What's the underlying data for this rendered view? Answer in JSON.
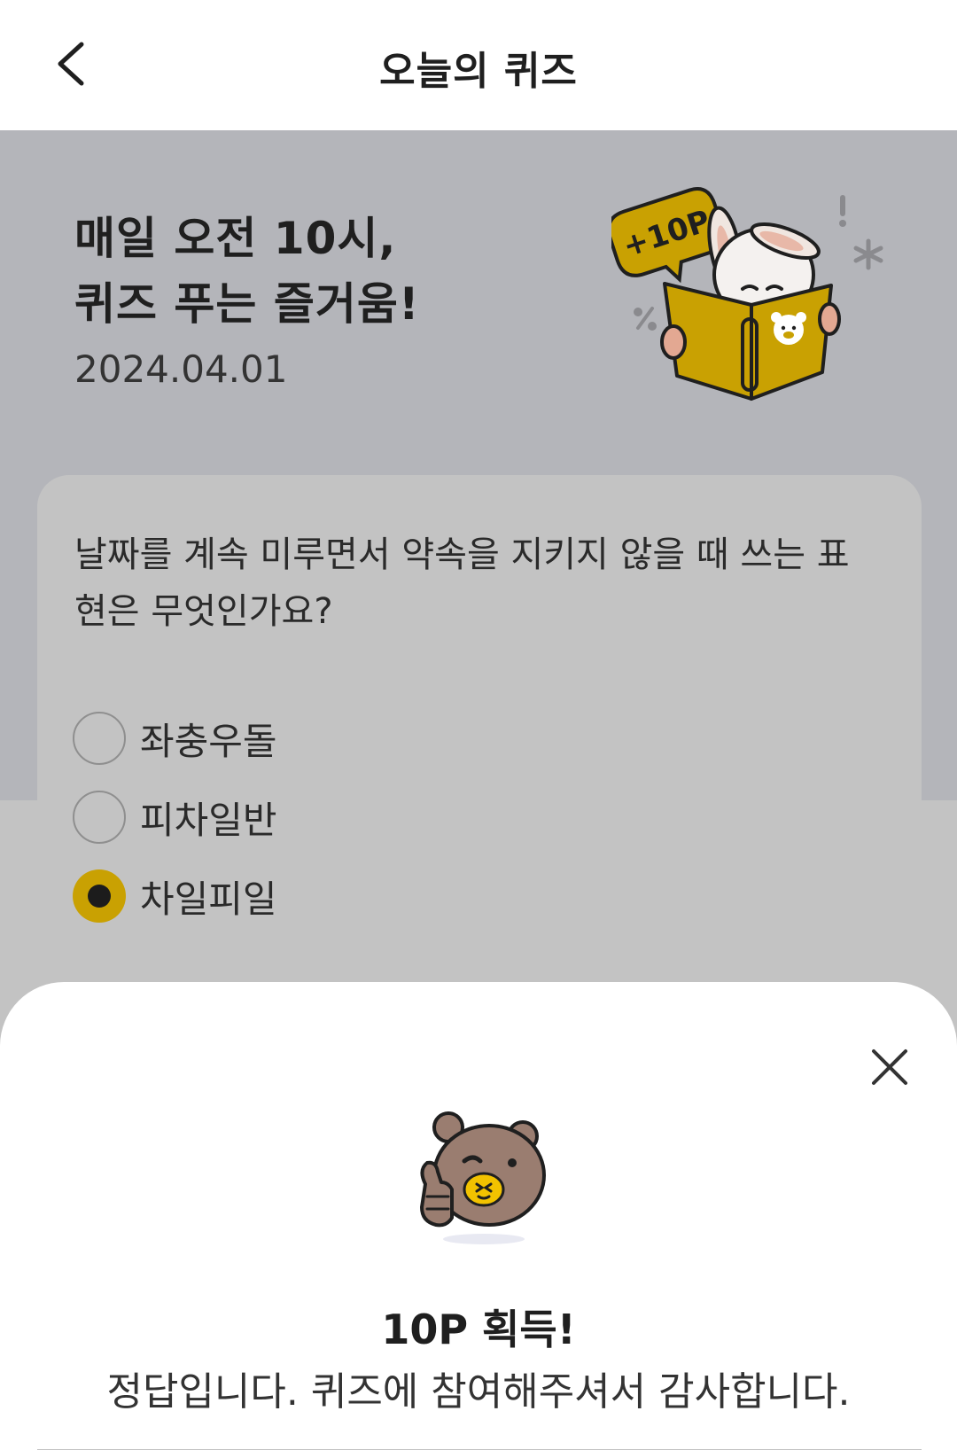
{
  "header": {
    "title": "오늘의 퀴즈",
    "back_icon": "chevron-left-icon"
  },
  "hero": {
    "title_line1": "매일 오전 10시,",
    "title_line2": "퀴즈 푸는 즐거움!",
    "date": "2024.04.01",
    "badge_text": "+10P",
    "illustration": "rabbit-reading-book-illustration"
  },
  "quiz": {
    "question": "날짜를 계속 미루면서 약속을 지키지 않을 때 쓰는 표현은 무엇인가요?",
    "options": [
      {
        "label": "좌충우돌",
        "selected": false
      },
      {
        "label": "피차일반",
        "selected": false
      },
      {
        "label": "차일피일",
        "selected": true
      }
    ]
  },
  "result_sheet": {
    "title": "10P 획득!",
    "message": "정답입니다. 퀴즈에 참여해주셔서 감사합니다.",
    "close_icon": "close-icon",
    "illustration": "bear-thumbs-up-wink-illustration"
  },
  "colors": {
    "accent": "#c9a102",
    "hero_bg": "#b4b5ba",
    "dim_bg": "#c3c3c3",
    "sheet_bg": "#ffffff"
  }
}
